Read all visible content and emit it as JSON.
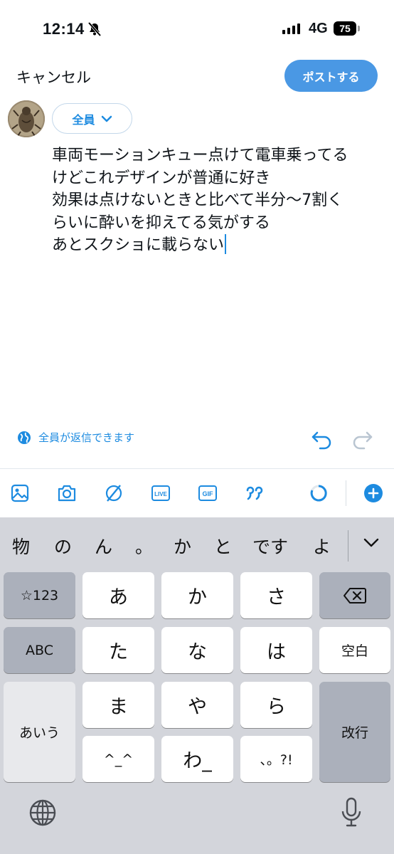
{
  "status_bar": {
    "time": "12:14",
    "network": "4G",
    "battery": "75"
  },
  "top_bar": {
    "cancel_label": "キャンセル",
    "post_label": "ポストする"
  },
  "audience": {
    "label": "全員"
  },
  "compose": {
    "lines": [
      "車両モーションキュー点けて電車乗ってる",
      "けどこれデザインが普通に好き",
      "効果は点けないときと比べて半分〜7割く",
      "らいに酔いを抑えてる気がする",
      "あとスクショに載らない"
    ]
  },
  "reply_setting": {
    "label": "全員が返信できます"
  },
  "toolbar": {
    "icons": [
      "image-icon",
      "camera-icon",
      "grok-icon",
      "live-icon",
      "gif-icon",
      "quote-icon",
      "progress-circle-icon",
      "add-icon"
    ],
    "live_text": "LIVE",
    "gif_text": "GIF",
    "accent": "#1d8be0"
  },
  "keyboard": {
    "candidates": [
      "物",
      "の",
      "ん",
      "。",
      "か",
      "と",
      "です",
      "よ"
    ],
    "keys": {
      "num": "☆123",
      "a": "あ",
      "ka": "か",
      "sa": "さ",
      "abc": "ABC",
      "ta": "た",
      "na": "な",
      "ha": "は",
      "space": "空白",
      "aiu": "あいう",
      "ma": "ま",
      "ya": "や",
      "ra": "ら",
      "enter": "改行",
      "kaomoji": "^_^",
      "wa": "わ_",
      "punct": "、。?!"
    }
  }
}
